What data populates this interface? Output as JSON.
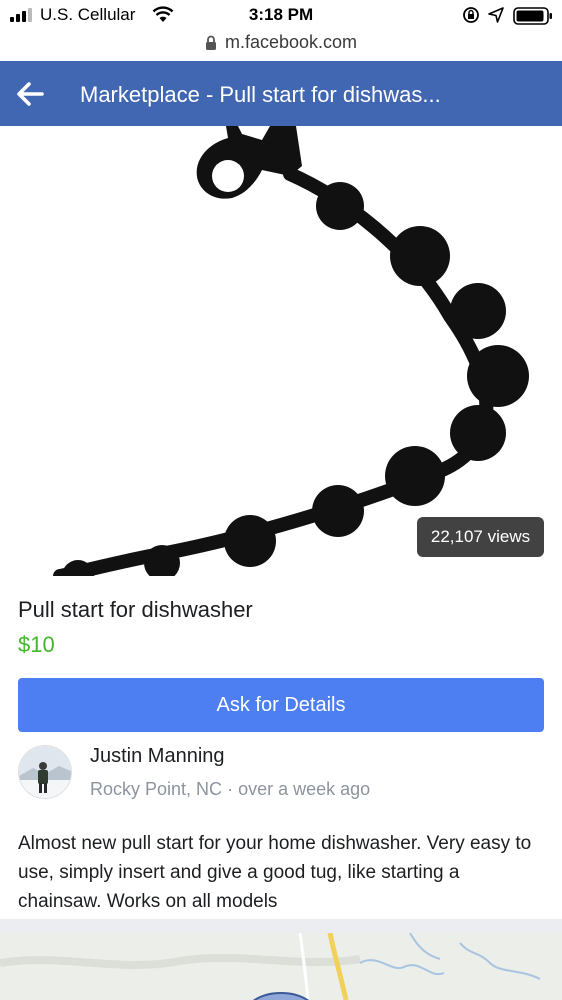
{
  "status_bar": {
    "carrier": "U.S. Cellular",
    "time": "3:18 PM",
    "signal_icon": "signal-bars-icon",
    "wifi_icon": "wifi-icon",
    "rotation_lock_icon": "rotation-lock-icon",
    "location_icon": "location-arrow-icon",
    "battery_icon": "battery-icon"
  },
  "browser": {
    "url": "m.facebook.com",
    "lock_icon": "lock-icon"
  },
  "header": {
    "back_icon": "back-arrow-icon",
    "title": "Marketplace - Pull start for dishwas...",
    "background_color": "#4267b2"
  },
  "listing": {
    "views": "22,107 views",
    "title": "Pull start for dishwasher",
    "price": "$10",
    "price_color": "#42b72a",
    "cta_label": "Ask for Details",
    "cta_color": "#4e7ff2",
    "seller": {
      "name": "Justin Manning",
      "location": "Rocky Point, NC",
      "separator": "·",
      "posted": "over a week ago"
    },
    "description": "Almost new pull start for your home dishwasher. Very easy to use, simply insert and give a good tug, like starting a chainsaw. Works on all models"
  }
}
